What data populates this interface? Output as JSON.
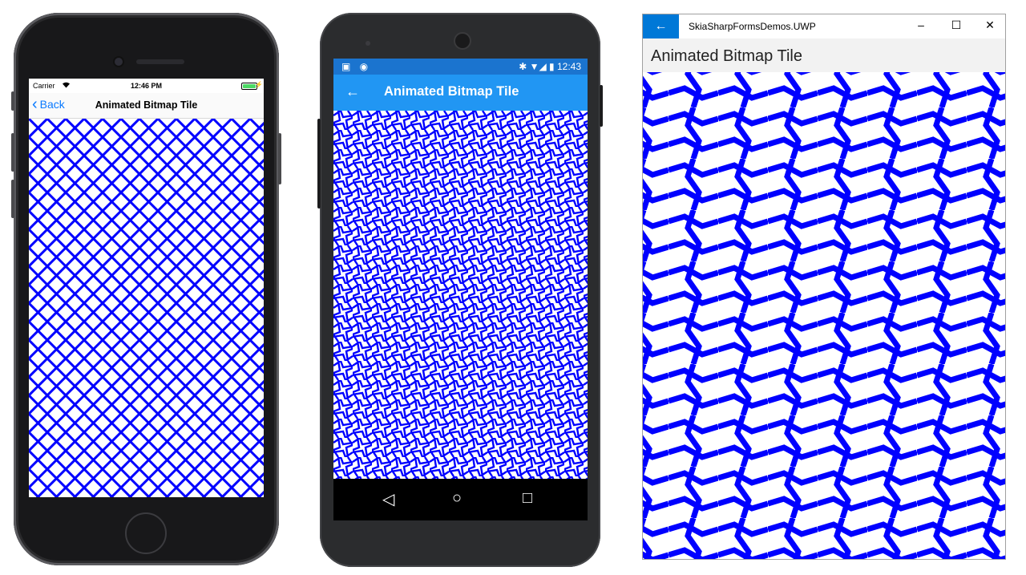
{
  "pattern_color": "#0000ff",
  "ios": {
    "carrier": "Carrier",
    "time": "12:46 PM",
    "back_label": "Back",
    "title": "Animated Bitmap Tile"
  },
  "android": {
    "time": "12:43",
    "title": "Animated Bitmap Tile",
    "status_icons": "✱ ▼◢ ▮",
    "nav_icons": [
      "back-triangle-icon",
      "home-circle-icon",
      "recents-square-icon"
    ]
  },
  "uwp": {
    "app_title": "SkiaSharpFormsDemos.UWP",
    "page_title": "Animated Bitmap Tile",
    "controls": [
      "minimize-icon",
      "maximize-icon",
      "close-icon"
    ]
  }
}
